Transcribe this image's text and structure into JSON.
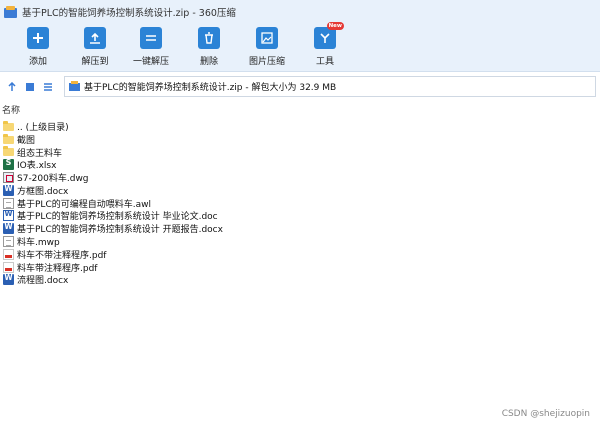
{
  "window": {
    "title": "基于PLC的智能饲养场控制系统设计.zip - 360压缩"
  },
  "toolbar": {
    "items": [
      {
        "label": "添加",
        "icon": "add-icon"
      },
      {
        "label": "解压到",
        "icon": "extract-to-icon"
      },
      {
        "label": "一键解压",
        "icon": "one-click-extract-icon"
      },
      {
        "label": "删除",
        "icon": "delete-icon"
      },
      {
        "label": "图片压缩",
        "icon": "image-compress-icon"
      },
      {
        "label": "工具",
        "icon": "tools-icon",
        "badge": "New"
      }
    ]
  },
  "nav": {
    "path_text": "基于PLC的智能饲养场控制系统设计.zip - 解包大小为 32.9 MB"
  },
  "list": {
    "column_name": "名称",
    "files": [
      {
        "name": ".. (上级目录)",
        "type": "folder"
      },
      {
        "name": "截图",
        "type": "folder"
      },
      {
        "name": "组态王料车",
        "type": "folder"
      },
      {
        "name": "IO表.xlsx",
        "type": "xls"
      },
      {
        "name": "S7-200料车.dwg",
        "type": "dwg"
      },
      {
        "name": "方框图.docx",
        "type": "word"
      },
      {
        "name": "基于PLC的可编程自动喂料车.awl",
        "type": "doc"
      },
      {
        "name": "基于PLC的智能饲养场控制系统设计 毕业论文.doc",
        "type": "wordlite"
      },
      {
        "name": "基于PLC的智能饲养场控制系统设计 开题报告.docx",
        "type": "word"
      },
      {
        "name": "料车.mwp",
        "type": "doc"
      },
      {
        "name": "料车不带注释程序.pdf",
        "type": "pdf"
      },
      {
        "name": "料车带注释程序.pdf",
        "type": "pdf"
      },
      {
        "name": "流程图.docx",
        "type": "word"
      }
    ]
  },
  "watermark": "CSDN @shejizuopin",
  "colors": {
    "toolbar_bg": "#e8f1fb",
    "accent": "#2b83d6"
  }
}
